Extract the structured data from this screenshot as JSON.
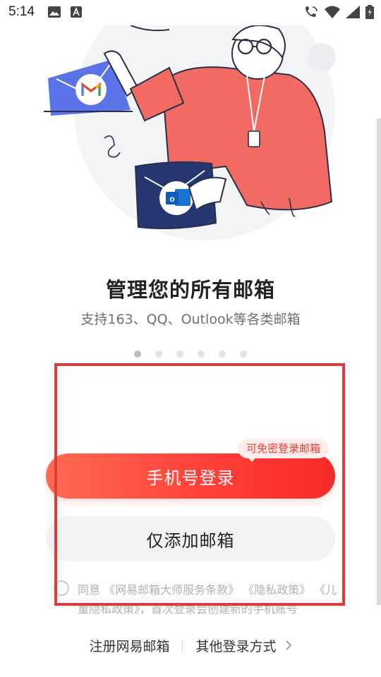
{
  "status_bar": {
    "time": "5:14",
    "left_icons": [
      "image-icon",
      "text-icon"
    ],
    "right_icons": [
      "wifi-call-icon",
      "wifi-icon",
      "signal-icon",
      "battery-icon"
    ]
  },
  "onboarding": {
    "title": "管理您的所有邮箱",
    "subtitle": "支持163、QQ、Outlook等各类邮箱",
    "page_count": 6,
    "active_page": 1,
    "illustration_icons": [
      "gmail-icon",
      "outlook-icon"
    ]
  },
  "login": {
    "promo_badge": "可免密登录邮箱",
    "phone_login_label": "手机号登录",
    "add_mailbox_label": "仅添加邮箱",
    "agreement": {
      "prefix": "同意",
      "terms_link": "《网易邮箱大师服务条款》",
      "privacy_link": "《隐私政策》",
      "children_privacy_link": "《儿童隐私政策》",
      "suffix": "，首次登录会创建新的手机账号"
    },
    "register_label": "注册网易邮箱",
    "other_login_label": "其他登录方式"
  },
  "colors": {
    "accent": "#ff3d37",
    "highlight_box": "#e03a3a",
    "secondary_bg": "#f2f2f2"
  }
}
